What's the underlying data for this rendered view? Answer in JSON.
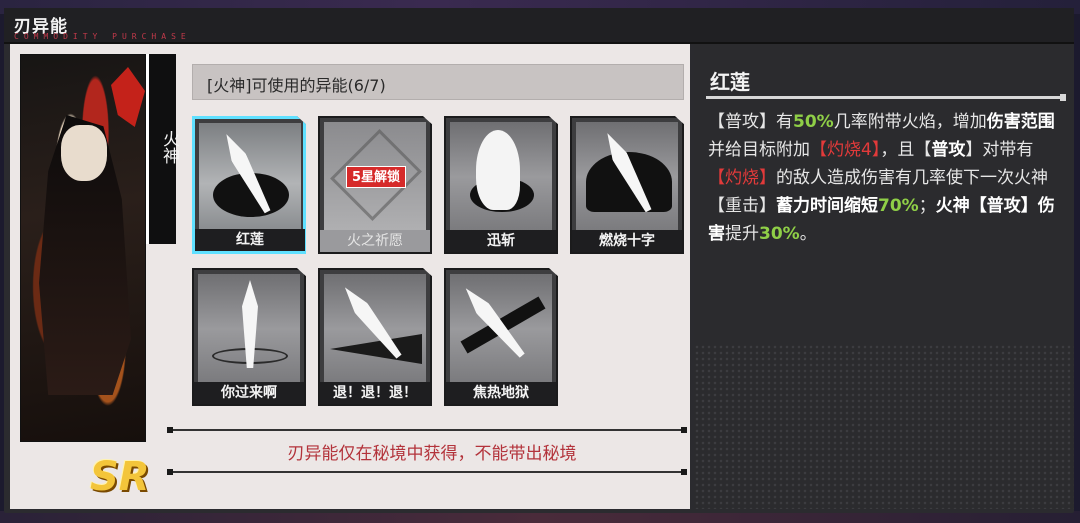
{
  "window": {
    "title": "刃异能",
    "subtitle": "COMMODITY PURCHASE"
  },
  "character": {
    "name": "火神",
    "rarity": "SR"
  },
  "skill_header": "[火神]可使用的异能(6/7)",
  "skills": [
    {
      "label": "红莲",
      "selected": true,
      "locked": false
    },
    {
      "label": "火之祈愿",
      "selected": false,
      "locked": true,
      "lock_text": "5星解锁"
    },
    {
      "label": "迅斩",
      "selected": false,
      "locked": false
    },
    {
      "label": "燃烧十字",
      "selected": false,
      "locked": false
    },
    {
      "label": "你过来啊",
      "selected": false,
      "locked": false
    },
    {
      "label": "退！退！退！",
      "selected": false,
      "locked": false
    },
    {
      "label": "焦热地狱",
      "selected": false,
      "locked": false
    }
  ],
  "notice": "刃异能仅在秘境中获得，不能带出秘境",
  "detail": {
    "title": "红莲",
    "segments": [
      {
        "t": "【普攻】有",
        "c": "n"
      },
      {
        "t": "50%",
        "c": "g"
      },
      {
        "t": "几率附带火焰，增加",
        "c": "n"
      },
      {
        "t": "伤害范围",
        "c": "w"
      },
      {
        "t": "并给目标附加",
        "c": "n"
      },
      {
        "t": "【灼烧4】",
        "c": "r"
      },
      {
        "t": "，且【",
        "c": "n"
      },
      {
        "t": "普攻",
        "c": "w"
      },
      {
        "t": "】对带有",
        "c": "n"
      },
      {
        "t": "【灼烧】",
        "c": "r"
      },
      {
        "t": "的敌人造成伤害有几率使下一次火神【重击】",
        "c": "n"
      },
      {
        "t": "蓄力时间缩短",
        "c": "w"
      },
      {
        "t": "70%",
        "c": "g"
      },
      {
        "t": "；",
        "c": "n"
      },
      {
        "t": "火神【普攻】伤害",
        "c": "w"
      },
      {
        "t": "提升",
        "c": "n"
      },
      {
        "t": "30%",
        "c": "g"
      },
      {
        "t": "。",
        "c": "n"
      }
    ]
  },
  "colors": {
    "accent_cyan": "#5fe0ff",
    "highlight_green": "#8fcf47",
    "highlight_red": "#e23a3a",
    "notice_red": "#b3333b",
    "lock_red": "#d62a2a"
  }
}
